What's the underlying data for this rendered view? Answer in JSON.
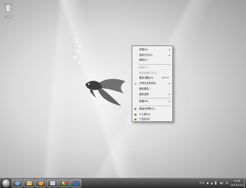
{
  "desktop": {
    "recycle_bin_label": "回收站"
  },
  "context_menu": {
    "items": [
      {
        "label": "查看(V)",
        "has_submenu": true,
        "disabled": false
      },
      {
        "label": "排序方式(O)",
        "has_submenu": true,
        "disabled": false
      },
      {
        "label": "刷新(E)",
        "has_submenu": false,
        "disabled": false
      },
      {
        "separator": true
      },
      {
        "label": "粘贴(P)",
        "has_submenu": false,
        "disabled": true
      },
      {
        "label": "粘贴快捷方式(S)",
        "has_submenu": false,
        "disabled": true
      },
      {
        "label": "撤消 删除(U)",
        "shortcut": "Ctrl+Z",
        "has_submenu": false,
        "disabled": false
      },
      {
        "label": "共享文件夹同步",
        "icon": "sync-icon",
        "has_submenu": true,
        "disabled": false
      },
      {
        "label": "图形属性...",
        "has_submenu": false,
        "disabled": false
      },
      {
        "label": "图形选项",
        "has_submenu": true,
        "disabled": false
      },
      {
        "separator": true
      },
      {
        "label": "新建(W)",
        "has_submenu": true,
        "disabled": false
      },
      {
        "separator": true
      },
      {
        "label": "屏幕分辨率(C)",
        "icon": "display-icon",
        "has_submenu": false,
        "disabled": false
      },
      {
        "label": "小工具(G)",
        "icon": "gadget-icon",
        "has_submenu": false,
        "disabled": false
      },
      {
        "label": "个性化(R)",
        "icon": "personalize-icon",
        "has_submenu": false,
        "disabled": false
      }
    ]
  },
  "taskbar": {
    "pinned": [
      "ie-icon",
      "explorer-icon",
      "media-player-icon",
      "app-icon",
      "chrome-icon",
      "word-icon"
    ],
    "tray_text": "CH ◆ ▲ ▌ ◀) ⊕",
    "clock_time": "9:45",
    "clock_date": "2013/1/21"
  },
  "colors": {
    "menu_bg": "#f0f0f0",
    "taskbar": "#3a3a3a"
  }
}
